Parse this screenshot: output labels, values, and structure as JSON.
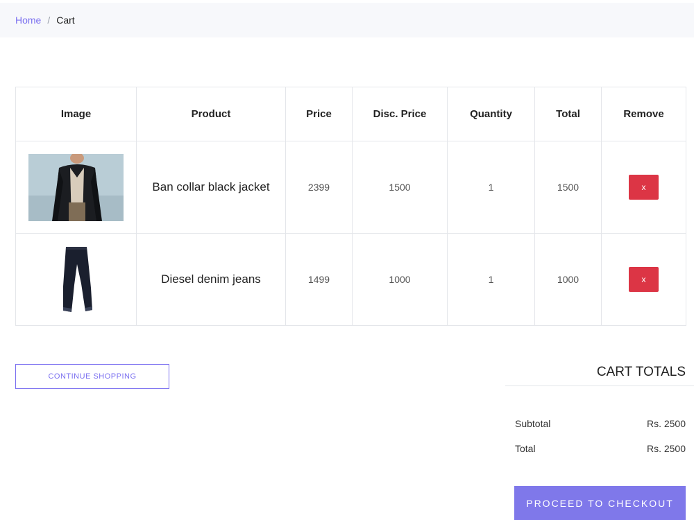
{
  "breadcrumb": {
    "home": "Home",
    "separator": "/",
    "current": "Cart"
  },
  "table": {
    "headers": [
      "Image",
      "Product",
      "Price",
      "Disc. Price",
      "Quantity",
      "Total",
      "Remove"
    ],
    "rows": [
      {
        "image_icon": "jacket-image",
        "product": "Ban collar black jacket",
        "price": "2399",
        "disc_price": "1500",
        "quantity": "1",
        "total": "1500",
        "remove_label": "x"
      },
      {
        "image_icon": "jeans-image",
        "product": "Diesel denim jeans",
        "price": "1499",
        "disc_price": "1000",
        "quantity": "1",
        "total": "1000",
        "remove_label": "x"
      }
    ]
  },
  "continue_label": "CONTINUE SHOPPING",
  "totals": {
    "title": "CART TOTALS",
    "subtotal_label": "Subtotal",
    "subtotal_value": "Rs. 2500",
    "total_label": "Total",
    "total_value": "Rs. 2500"
  },
  "checkout_label": "PROCEED TO CHECKOUT",
  "colors": {
    "accent": "#7f78ea",
    "danger": "#dc3545",
    "link": "#7a6ff0"
  }
}
